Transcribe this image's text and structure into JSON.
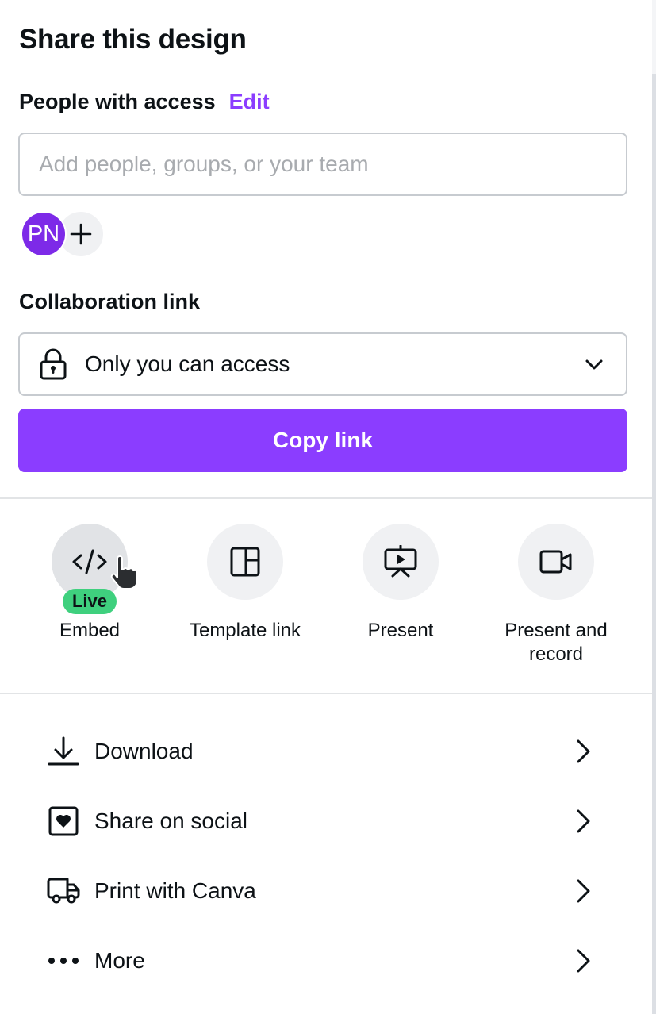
{
  "header": {
    "title": "Share this design"
  },
  "people_access": {
    "label": "People with access",
    "edit_label": "Edit",
    "input_placeholder": "Add people, groups, or your team",
    "input_value": "",
    "members": [
      {
        "initials": "PN",
        "color": "#7d2ae8"
      }
    ],
    "add_icon": "plus-icon"
  },
  "collaboration": {
    "label": "Collaboration link",
    "access_icon": "lock-icon",
    "access_value": "Only you can access",
    "dropdown_icon": "chevron-down-icon",
    "copy_label": "Copy link"
  },
  "quick_actions": [
    {
      "label": "Embed",
      "icon": "code-icon",
      "badge": "Live",
      "hovered": true
    },
    {
      "label": "Template link",
      "icon": "template-layout-icon"
    },
    {
      "label": "Present",
      "icon": "presentation-screen-icon"
    },
    {
      "label": "Present and record",
      "icon": "video-camera-icon"
    }
  ],
  "menu": [
    {
      "label": "Download",
      "icon": "download-icon"
    },
    {
      "label": "Share on social",
      "icon": "heart-square-icon"
    },
    {
      "label": "Print with Canva",
      "icon": "delivery-truck-icon"
    },
    {
      "label": "More",
      "icon": "more-horizontal-icon"
    }
  ],
  "colors": {
    "accent": "#8b3dff",
    "avatar": "#7d2ae8",
    "live_badge": "#3fd07e",
    "text": "#0d1216",
    "icon_bg": "#f0f1f3"
  }
}
